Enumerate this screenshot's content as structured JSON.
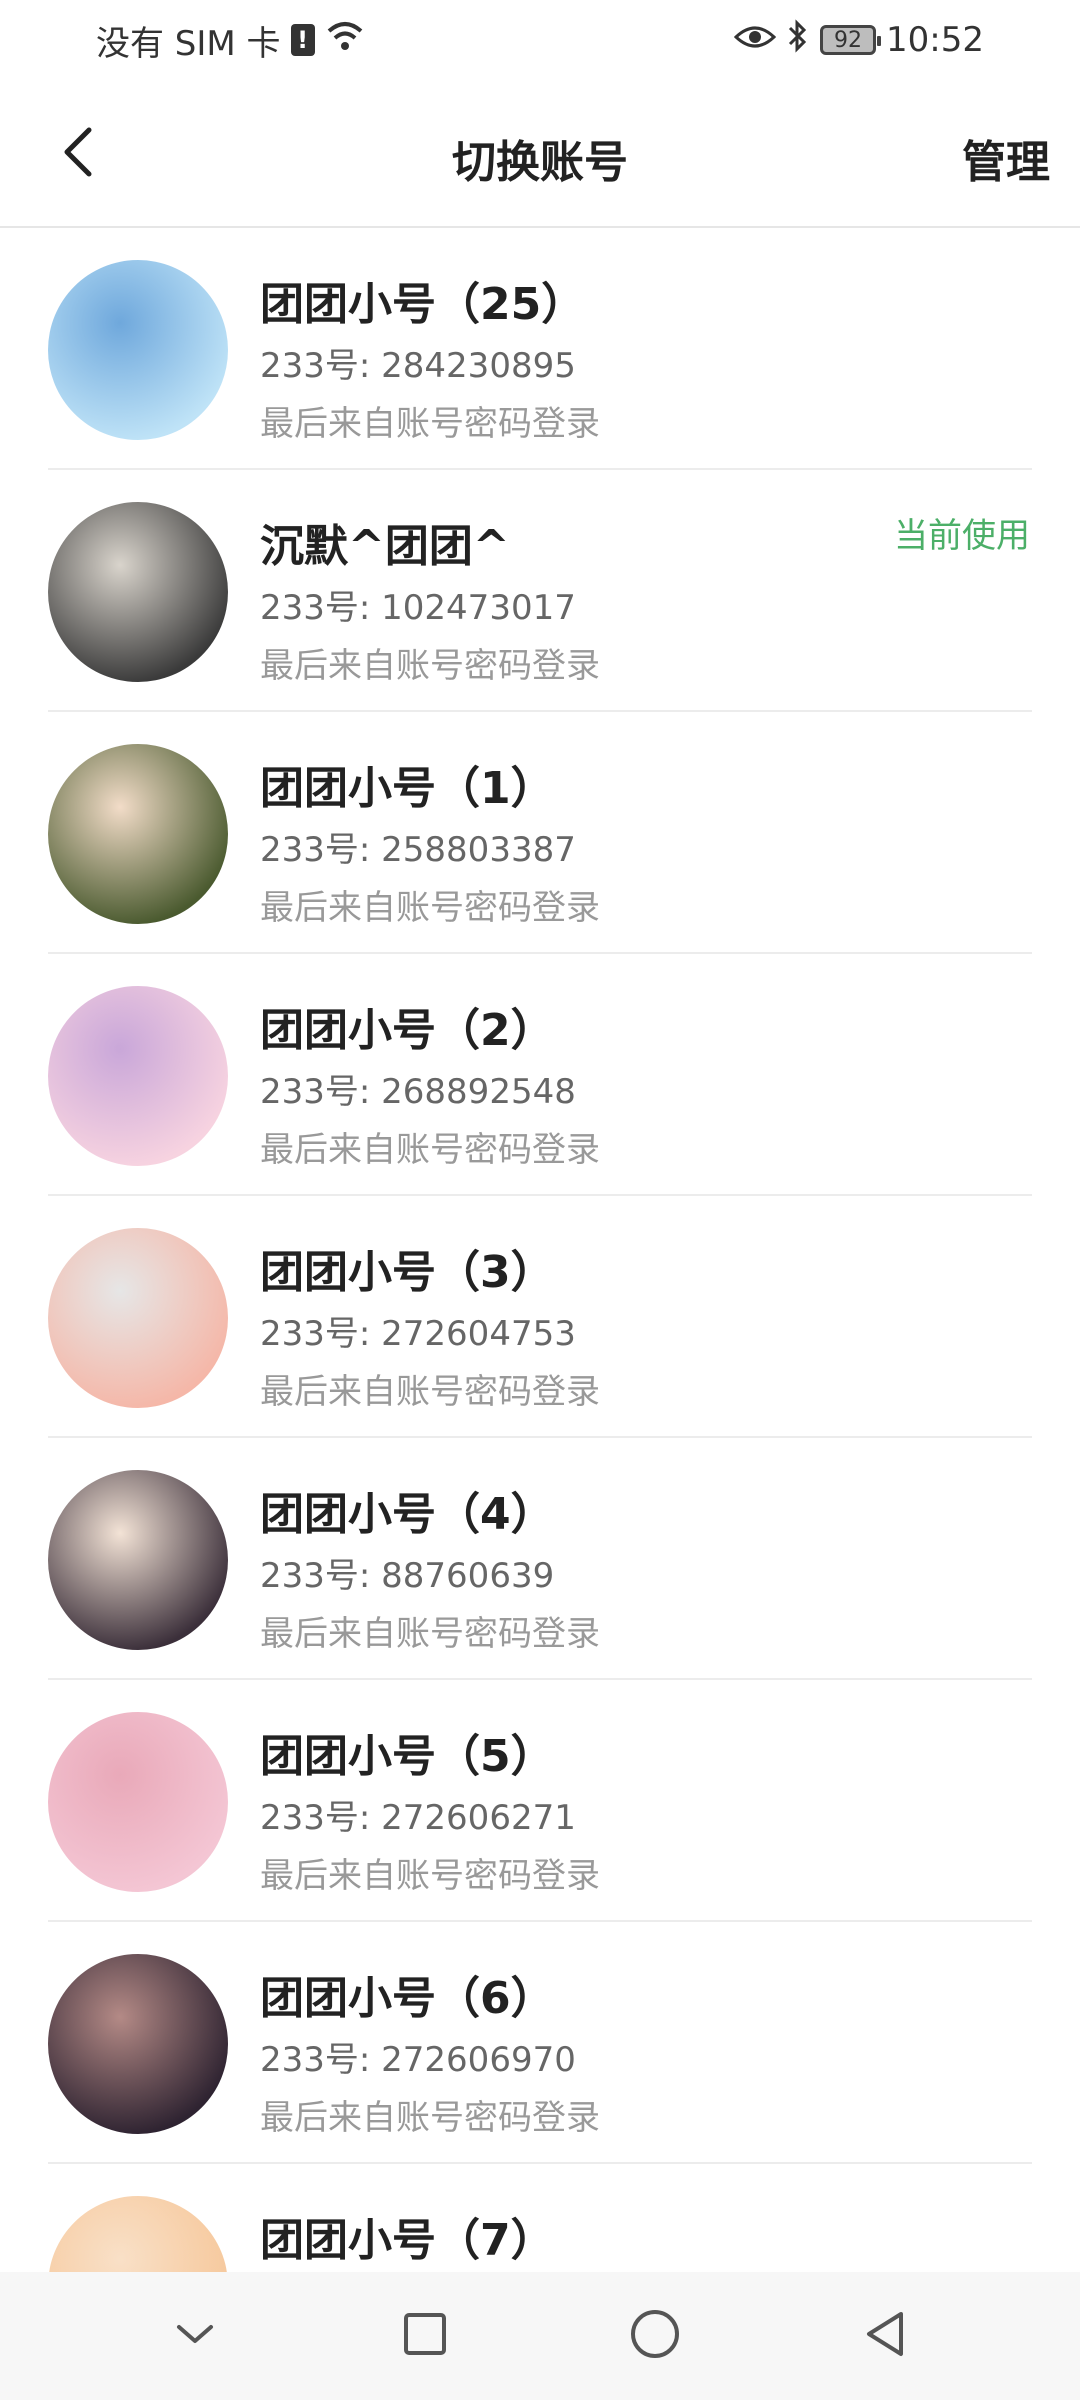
{
  "status_bar": {
    "carrier": "没有 SIM 卡",
    "sim_alert": "!",
    "battery": "92",
    "time": "10:52"
  },
  "header": {
    "title": "切换账号",
    "manage_label": "管理"
  },
  "accounts": [
    {
      "name": "团团小号（25）",
      "id": "233号: 284230895",
      "login": "最后来自账号密码登录",
      "current": ""
    },
    {
      "name": "沉默^团团^",
      "id": "233号: 102473017",
      "login": "最后来自账号密码登录",
      "current": "当前使用"
    },
    {
      "name": "团团小号（1）",
      "id": "233号: 258803387",
      "login": "最后来自账号密码登录",
      "current": ""
    },
    {
      "name": "团团小号（2）",
      "id": "233号: 268892548",
      "login": "最后来自账号密码登录",
      "current": ""
    },
    {
      "name": "团团小号（3）",
      "id": "233号: 272604753",
      "login": "最后来自账号密码登录",
      "current": ""
    },
    {
      "name": "团团小号（4）",
      "id": "233号: 88760639",
      "login": "最后来自账号密码登录",
      "current": ""
    },
    {
      "name": "团团小号（5）",
      "id": "233号: 272606271",
      "login": "最后来自账号密码登录",
      "current": ""
    },
    {
      "name": "团团小号（6）",
      "id": "233号: 272606970",
      "login": "最后来自账号密码登录",
      "current": ""
    },
    {
      "name": "团团小号（7）",
      "id": "",
      "login": "",
      "current": ""
    }
  ],
  "colors": {
    "accent_green": "#4caf68",
    "avatar_gradients": [
      [
        "#bfe3f7",
        "#6fa8dc"
      ],
      [
        "#3a3a3a",
        "#d9d4cc"
      ],
      [
        "#4a5a2f",
        "#f2dcc8"
      ],
      [
        "#f7d3e0",
        "#c9a7d9"
      ],
      [
        "#f5b7a8",
        "#e6e6e6"
      ],
      [
        "#3b2f3a",
        "#f3e3d6"
      ],
      [
        "#f4c6d4",
        "#e9a9b9"
      ],
      [
        "#2e2331",
        "#b48a86"
      ],
      [
        "#f6c79a",
        "#f9e0c7"
      ]
    ]
  },
  "icons": {
    "back": "chevron-left-icon",
    "wifi": "wifi-icon",
    "eye": "eye-icon",
    "bluetooth": "bluetooth-icon",
    "nav_down": "chevron-down-icon",
    "nav_recents": "square-icon",
    "nav_home": "circle-icon",
    "nav_back": "triangle-back-icon"
  }
}
